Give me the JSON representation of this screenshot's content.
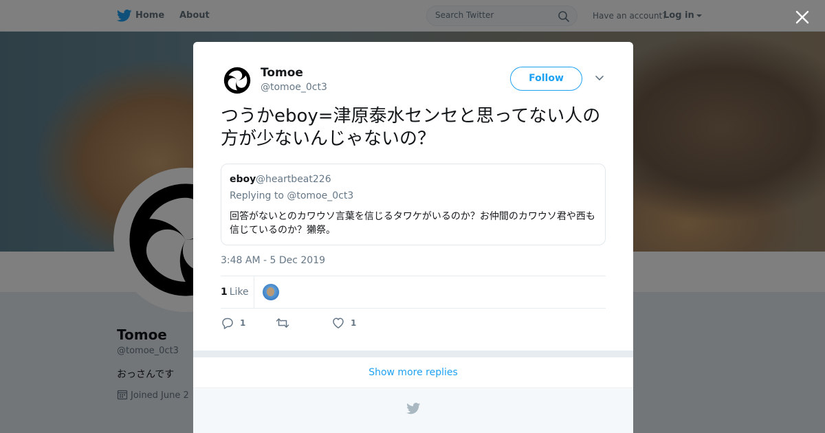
{
  "nav": {
    "home_label": "Home",
    "about_label": "About",
    "search_placeholder": "Search Twitter",
    "have_account": "Have an account?",
    "login_label": "Log in"
  },
  "profile": {
    "name": "Tomoe",
    "handle": "@tomoe_0ct3",
    "bio": "おっさんです",
    "joined": "Joined June 2"
  },
  "tweet": {
    "author_name": "Tomoe",
    "author_handle": "@tomoe_0ct3",
    "follow_label": "Follow",
    "text": "つうかeboy=津原泰水センセと思ってない人の方が少ないんじゃないの？",
    "quote": {
      "name": "eboy",
      "handle": "@heartbeat226",
      "replying_to": "Replying to @tomoe_0ct3",
      "text": "回答がないとのカワウソ言葉を信じるタワケがいるのか？お仲間のカワウソ君や西も信じているのか？獺祭。"
    },
    "timestamp": "3:48 AM - 5 Dec 2019",
    "likes_count": "1",
    "likes_label": "Like",
    "reply_count": "1",
    "retweet_count": "",
    "like_action_count": "1"
  },
  "show_more_label": "Show more replies",
  "colors": {
    "accent": "#1da1f2",
    "secondary_text": "#657786",
    "primary_text": "#14171a"
  },
  "icons": [
    "twitter-bird-icon",
    "search-icon",
    "close-icon",
    "chevron-down-icon",
    "reply-icon",
    "retweet-icon",
    "heart-icon",
    "calendar-icon"
  ]
}
